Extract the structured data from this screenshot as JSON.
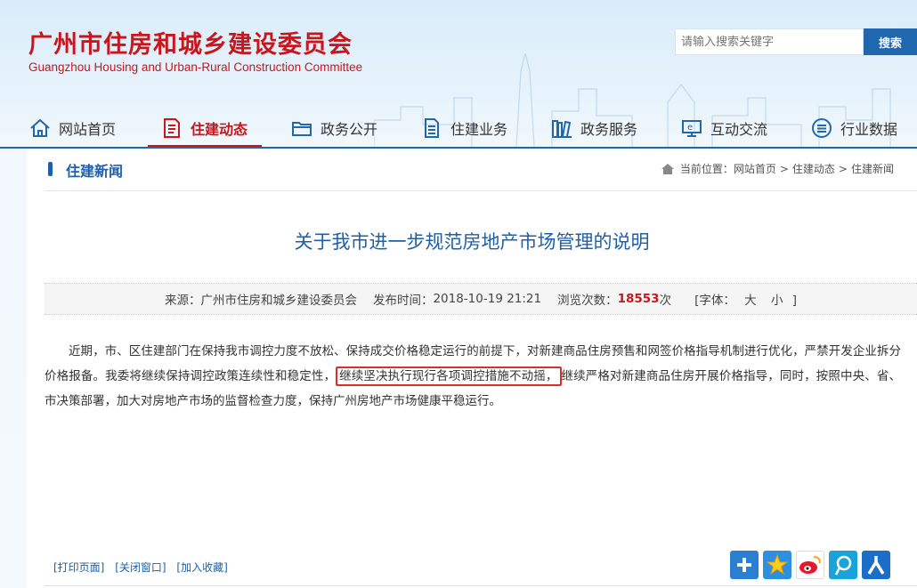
{
  "header": {
    "title": "广州市住房和城乡建设委员会",
    "subtitle": "Guangzhou Housing and Urban-Rural Construction Committee",
    "search_placeholder": "请输入搜索关键字",
    "search_button": "搜索",
    "accent_color": "#c8161d",
    "brand_color": "#2167ae"
  },
  "nav": {
    "items": [
      {
        "label": "网站首页",
        "icon": "home-icon"
      },
      {
        "label": "住建动态",
        "icon": "document-icon",
        "active": true
      },
      {
        "label": "政务公开",
        "icon": "folder-icon"
      },
      {
        "label": "住建业务",
        "icon": "file-icon"
      },
      {
        "label": "政务服务",
        "icon": "books-icon"
      },
      {
        "label": "互动交流",
        "icon": "chat-screen-icon"
      },
      {
        "label": "行业数据",
        "icon": "list-circle-icon"
      }
    ]
  },
  "section": {
    "title": "住建新闻",
    "breadcrumb_prefix": "当前位置：",
    "breadcrumb": [
      "网站首页",
      "住建动态",
      "住建新闻"
    ],
    "breadcrumb_sep": ">"
  },
  "article": {
    "title": "关于我市进一步规范房地产市场管理的说明",
    "source": "来源：广州市住房和城乡建设委员会",
    "publish_label": "发布时间：",
    "publish_time": "2018-10-19 21:21",
    "views_label": "浏览次数：",
    "views": "18553",
    "views_unit": "次",
    "font_label": "[字体：",
    "font_large": "大",
    "font_small": "小",
    "font_close": "]",
    "body_part1": "近期，市、区住建部门在保持我市调控力度不放松、保持成交价格稳定运行的前提下，对新建商品住房预售和网签价格指导机制进行优化，严禁开发企业拆分价格报备。我委将继续保持调控政策连续性和稳定性，",
    "body_highlight": "继续坚决执行现行各项调控措施不动摇，",
    "body_part2": "继续严格对新建商品住房开展价格指导，同时，按照中央、省、市决策部署，加大对房地产市场的监督检查力度，保持广州房地产市场健康平稳运行。"
  },
  "footer": {
    "print": "[打印页面]",
    "close": "[关闭窗口]",
    "favorite": "[加入收藏]",
    "share_icons": [
      "plus-share-icon",
      "qzone-star-icon",
      "weibo-icon",
      "tencent-weibo-icon",
      "renren-icon"
    ]
  }
}
